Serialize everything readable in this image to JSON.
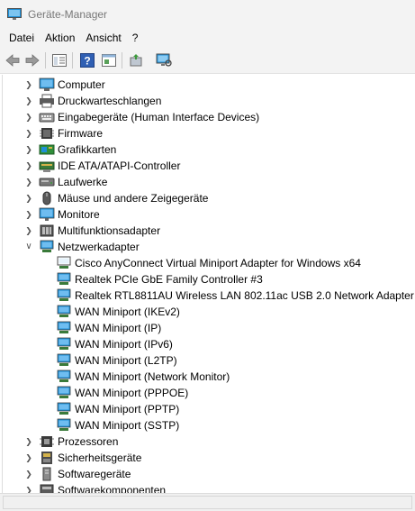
{
  "window": {
    "title": "Geräte-Manager"
  },
  "menu": [
    "Datei",
    "Aktion",
    "Ansicht",
    "?"
  ],
  "toolbar": [
    "back-icon",
    "forward-icon",
    "properties-icon",
    "help-icon",
    "view-icon",
    "update-driver-icon",
    "scan-hardware-icon"
  ],
  "categories_top": [
    {
      "label": "Computer",
      "icon": "computer-icon"
    },
    {
      "label": "Druckwarteschlangen",
      "icon": "printer-icon"
    },
    {
      "label": "Eingabegeräte (Human Interface Devices)",
      "icon": "hid-icon"
    },
    {
      "label": "Firmware",
      "icon": "firmware-icon"
    },
    {
      "label": "Grafikkarten",
      "icon": "display-adapter-icon"
    },
    {
      "label": "IDE ATA/ATAPI-Controller",
      "icon": "ide-controller-icon"
    },
    {
      "label": "Laufwerke",
      "icon": "disk-drive-icon"
    },
    {
      "label": "Mäuse und andere Zeigegeräte",
      "icon": "mouse-icon"
    },
    {
      "label": "Monitore",
      "icon": "monitor-icon"
    },
    {
      "label": "Multifunktionsadapter",
      "icon": "multifunction-icon"
    }
  ],
  "network": {
    "label": "Netzwerkadapter",
    "children": [
      "Cisco AnyConnect Virtual Miniport Adapter for Windows x64",
      "Realtek PCIe GbE Family Controller #3",
      "Realtek RTL8811AU Wireless LAN 802.11ac USB 2.0 Network Adapter",
      "WAN Miniport (IKEv2)",
      "WAN Miniport (IP)",
      "WAN Miniport (IPv6)",
      "WAN Miniport (L2TP)",
      "WAN Miniport (Network Monitor)",
      "WAN Miniport (PPPOE)",
      "WAN Miniport (PPTP)",
      "WAN Miniport (SSTP)"
    ]
  },
  "categories_bottom": [
    {
      "label": "Prozessoren",
      "icon": "processor-icon"
    },
    {
      "label": "Sicherheitsgeräte",
      "icon": "security-device-icon"
    },
    {
      "label": "Softwaregeräte",
      "icon": "software-device-icon"
    },
    {
      "label": "Softwarekomponenten",
      "icon": "software-component-icon"
    }
  ],
  "colors": {
    "chrome": "#f3f3f3",
    "monitor_blue": "#1e8fd6",
    "text": "#000000"
  }
}
